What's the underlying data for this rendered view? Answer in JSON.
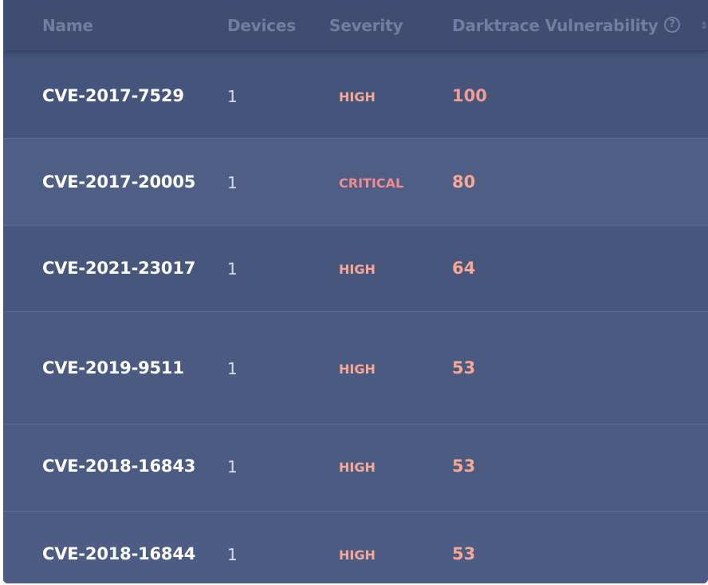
{
  "table": {
    "columns": {
      "name": "Name",
      "devices": "Devices",
      "severity": "Severity",
      "vulnerability": "Darktrace Vulnerability"
    },
    "help_icon_glyph": "?",
    "rows": [
      {
        "name": "CVE-2017-7529",
        "devices": "1",
        "severity": "HIGH",
        "score": "100"
      },
      {
        "name": "CVE-2017-20005",
        "devices": "1",
        "severity": "CRITICAL",
        "score": "80"
      },
      {
        "name": "CVE-2021-23017",
        "devices": "1",
        "severity": "HIGH",
        "score": "64"
      },
      {
        "name": "CVE-2019-9511",
        "devices": "1",
        "severity": "HIGH",
        "score": "53"
      },
      {
        "name": "CVE-2018-16843",
        "devices": "1",
        "severity": "HIGH",
        "score": "53"
      },
      {
        "name": "CVE-2018-16844",
        "devices": "1",
        "severity": "HIGH",
        "score": "53"
      }
    ]
  },
  "colors": {
    "panel_background": "#47567c",
    "header_background": "#3f4d70",
    "header_text": "#717e9e",
    "name_text": "#ffffff",
    "high_severity": "#f6a895",
    "critical_severity": "#f08a8c",
    "score_high": "#f6a895",
    "score_top": "#f29a95"
  }
}
